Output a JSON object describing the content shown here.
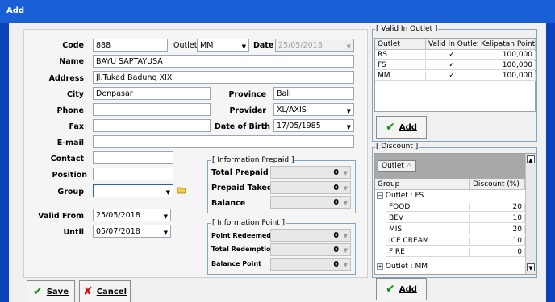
{
  "window": {
    "title": "Add"
  },
  "form": {
    "code": {
      "label": "Code",
      "value": "888"
    },
    "outlet": {
      "label": "Outlet",
      "value": "MM"
    },
    "date": {
      "label": "Date",
      "value": "25/05/2018"
    },
    "name": {
      "label": "Name",
      "value": "BAYU SAPTAYUSA"
    },
    "address": {
      "label": "Address",
      "value": "Jl.Tukad Badung XIX"
    },
    "city": {
      "label": "City",
      "value": "Denpasar"
    },
    "province": {
      "label": "Province",
      "value": "Bali"
    },
    "phone": {
      "label": "Phone",
      "value": ""
    },
    "provider": {
      "label": "Provider",
      "value": "XL/AXIS"
    },
    "fax": {
      "label": "Fax",
      "value": ""
    },
    "dob": {
      "label": "Date of Birth",
      "value": "17/05/1985"
    },
    "email": {
      "label": "E-mail",
      "value": ""
    },
    "contact": {
      "label": "Contact",
      "value": ""
    },
    "position": {
      "label": "Position",
      "value": ""
    },
    "group": {
      "label": "Group",
      "value": ""
    },
    "valid_from": {
      "label": "Valid From",
      "value": "25/05/2018"
    },
    "until": {
      "label": "Until",
      "value": "05/07/2018"
    }
  },
  "prepaid": {
    "title": "[ Information Prepaid ]",
    "total_prepaid": {
      "label": "Total Prepaid",
      "value": "0"
    },
    "prepaid_taked": {
      "label": "Prepaid Taked",
      "value": "0"
    },
    "balance": {
      "label": "Balance",
      "value": "0"
    }
  },
  "point": {
    "title": "[ Information Point ]",
    "point_redeemed": {
      "label": "Point Redeemed",
      "value": "0"
    },
    "total_redemption": {
      "label": "Total Redemption",
      "value": "0"
    },
    "balance_point": {
      "label": "Balance Point",
      "value": "0"
    }
  },
  "buttons": {
    "save": "Save",
    "cancel": "Cancel",
    "add": "Add"
  },
  "valid_outlet": {
    "title": "[ Valid In Outlet ]",
    "headers": [
      "Outlet",
      "Valid In Outlet",
      "Kelipatan Point"
    ],
    "rows": [
      {
        "outlet": "RS",
        "valid": "✓",
        "kelipatan": "100,000"
      },
      {
        "outlet": "FS",
        "valid": "✓",
        "kelipatan": "100,000"
      },
      {
        "outlet": "MM",
        "valid": "✓",
        "kelipatan": "100,000"
      }
    ]
  },
  "discount": {
    "title": "[ Discount ]",
    "groupby_chip": "Outlet",
    "headers": [
      "Group",
      "Discount (%)"
    ],
    "group1": "Outlet : FS",
    "rows": [
      {
        "group": "FOOD",
        "discount": "20"
      },
      {
        "group": "BEV",
        "discount": "10"
      },
      {
        "group": "MIS",
        "discount": "20"
      },
      {
        "group": "ICE CREAM",
        "discount": "10"
      },
      {
        "group": "FIRE",
        "discount": "0"
      }
    ],
    "group2": "Outlet : MM"
  },
  "colors": {
    "titlebar": "#1a5fd6",
    "desktop": "#0a44b8",
    "accent_green": "#1a8a1a",
    "cancel_red": "#cc1111"
  }
}
